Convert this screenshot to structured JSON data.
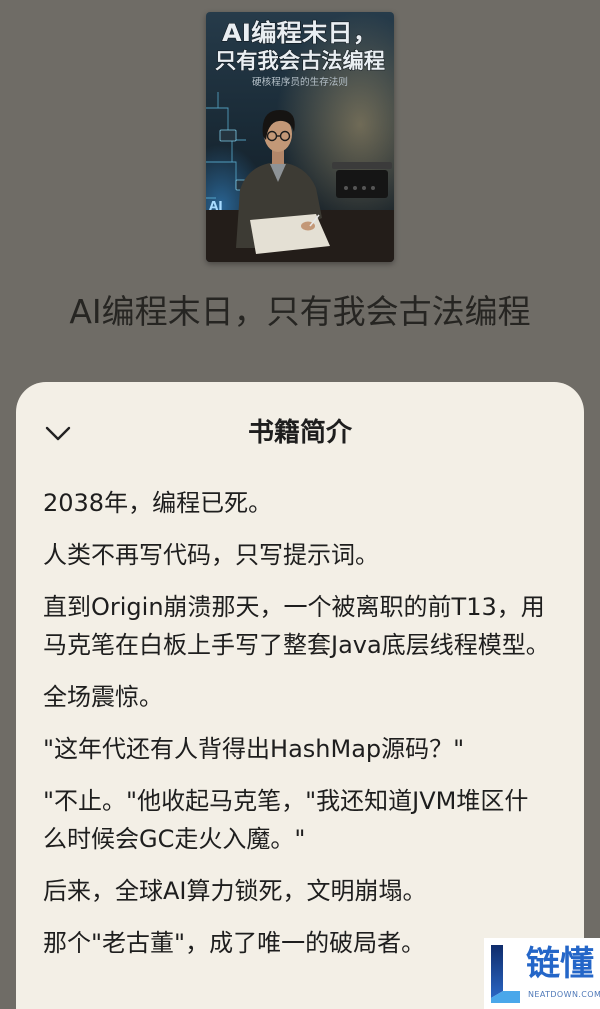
{
  "book": {
    "title": "AI编程末日，只有我会古法编程",
    "cover": {
      "title_line1": "AI编程末日，",
      "title_line2": "只有我会古法编程",
      "subtitle": "硬核程序员的生存法则",
      "sign": "AI"
    }
  },
  "sheet": {
    "title": "书籍简介",
    "collapse_icon": "chevron-down-icon",
    "paragraphs": [
      "2038年，编程已死。",
      "人类不再写代码，只写提示词。",
      "直到Origin崩溃那天，一个被离职的前T13，用马克笔在白板上手写了整套Java底层线程模型。",
      "全场震惊。",
      "\"这年代还有人背得出HashMap源码？\"",
      "\"不止。\"他收起马克笔，\"我还知道JVM堆区什么时候会GC走火入魔。\"",
      "后来，全球AI算力锁死，文明崩塌。",
      "那个\"老古董\"，成了唯一的破局者。"
    ]
  },
  "watermark": {
    "logo_icon": "l-logo-icon",
    "brand": "链懂",
    "domain": "NEATDOWN.COM"
  },
  "colors": {
    "backdrop": "#6f6c66",
    "sheet_background": "#f3efe6",
    "body_text": "#1e1e1e",
    "title_text": "#262522",
    "brand_blue": "#2466c8"
  }
}
